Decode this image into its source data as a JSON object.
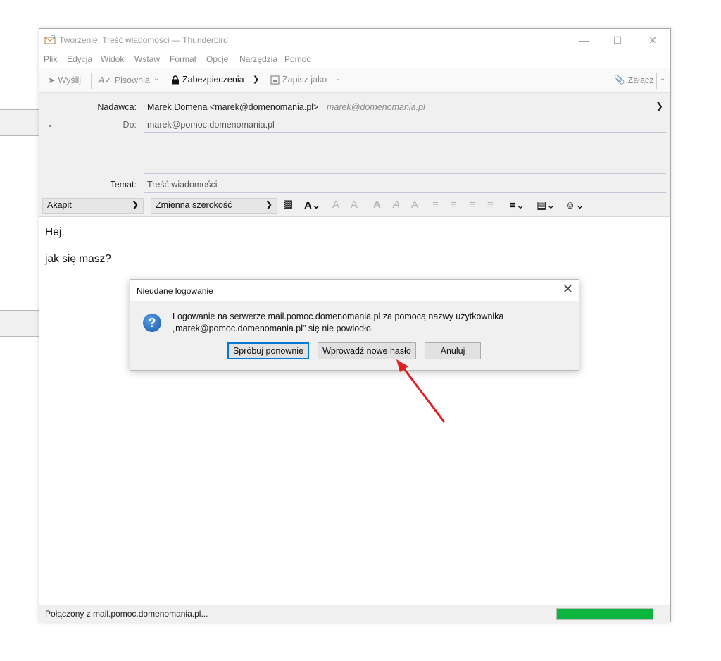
{
  "window": {
    "title": "Tworzenie: Treść wiadomości — Thunderbird",
    "controls": [
      "—",
      "☐",
      "✕"
    ]
  },
  "menubar": {
    "items": [
      {
        "label": "Plik"
      },
      {
        "label": "Edycja"
      },
      {
        "label": "Widok"
      },
      {
        "label": "Wstaw"
      },
      {
        "label": "Format"
      },
      {
        "label": "Opcje"
      },
      {
        "label": "Narzędzia"
      },
      {
        "label": "Pomoc"
      }
    ]
  },
  "toolbar": {
    "send_label": "Wyślij",
    "spelling_label": "Pisownia",
    "security_label": "Zabezpieczenia",
    "save_label": "Zapisz jako",
    "attach_label": "Załącz"
  },
  "headers": {
    "from_label": "Nadawca:",
    "from_name": "Marek Domena <marek@domenomania.pl>",
    "from_identity": "marek@domenomania.pl",
    "to_label": "Do:",
    "to_value": "marek@pomoc.domenomania.pl",
    "subject_label": "Temat:",
    "subject_value": "Treść wiadomości"
  },
  "format": {
    "paragraph_style": "Akapit",
    "font": "Zmienna szerokość"
  },
  "message": {
    "line1": "Hej,",
    "line2": "jak się masz?"
  },
  "status": {
    "text": "Połączony z mail.pomoc.domenomania.pl...",
    "progress": 1.0,
    "progress_color": "#0cb53d"
  },
  "dialog": {
    "title": "Nieudane logowanie",
    "close": "✕",
    "icon": "question-icon",
    "message_line1": "Logowanie na serwerze mail.pomoc.domenomania.pl za pomocą nazwy użytkownika",
    "message_line2": "„marek@pomoc.domenomania.pl\" się nie powiodło.",
    "retry_label": "Spróbuj ponownie",
    "new_password_label": "Wprowadź nowe hasło",
    "cancel_label": "Anuluj"
  },
  "annotation": {
    "arrow_color": "#e02020"
  }
}
